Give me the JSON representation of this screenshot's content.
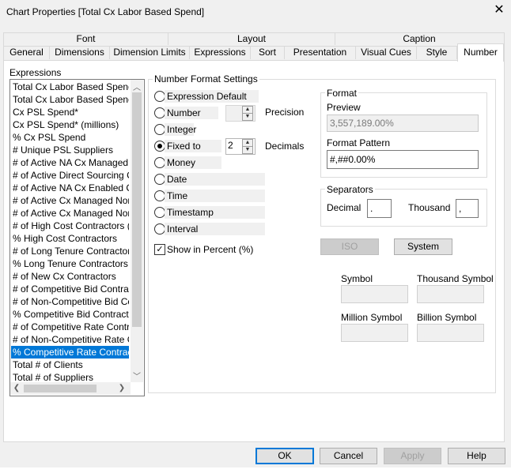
{
  "window": {
    "title": "Chart Properties [Total Cx Labor Based Spend]",
    "close": "✕"
  },
  "tabs_row1": [
    "Font",
    "Layout",
    "Caption"
  ],
  "tabs_row2": [
    "General",
    "Dimensions",
    "Dimension Limits",
    "Expressions",
    "Sort",
    "Presentation",
    "Visual Cues",
    "Style",
    "Number"
  ],
  "active_tab": "Number",
  "expressions": {
    "label": "Expressions",
    "items": [
      "Total Cx Labor Based Spend",
      "Total Cx Labor Based Spend (m",
      "Cx PSL Spend*",
      "Cx PSL Spend* (millions)",
      "% Cx PSL Spend",
      "# Unique PSL Suppliers",
      "# of Active NA Cx Managed Co",
      "# of Active Direct Sourcing Cor",
      "# of Active NA Cx Enabled Con",
      "# of Active Cx Managed Non-C",
      "# of Active Cx Managed Non-C",
      "# of High Cost Contractors (Bill",
      "% High Cost Contractors",
      "# of Long Tenure Contractors (",
      "% Long Tenure Contractors",
      "# of New Cx Contractors",
      "# of Competitive Bid Contractor",
      "# of Non-Competitive Bid Contr",
      " % Competitive Bid Contractors",
      "# of Competitive Rate Contracto",
      "# of Non-Competitive Rate Con",
      " % Competitive Rate Contractor",
      "Total # of Clients",
      "Total # of Suppliers"
    ],
    "selected_index": 21
  },
  "number_format": {
    "group_label": "Number Format Settings",
    "options": [
      "Expression Default",
      "Number",
      "Integer",
      "Fixed to",
      "Money",
      "Date",
      "Time",
      "Timestamp",
      "Interval"
    ],
    "selected": "Fixed to",
    "precision_label": "Precision",
    "precision_value": "",
    "decimals_label": "Decimals",
    "decimals_value": "2",
    "show_percent_label": "Show in Percent (%)",
    "show_percent_checked": true,
    "check_mark": "✓"
  },
  "format": {
    "group_label": "Format",
    "preview_label": "Preview",
    "preview_value": "3,557,189.00%",
    "pattern_label": "Format Pattern",
    "pattern_value": "#,##0.00%"
  },
  "separators": {
    "group_label": "Separators",
    "decimal_label": "Decimal",
    "decimal_value": ".",
    "thousand_label": "Thousand",
    "thousand_value": ","
  },
  "buttons": {
    "iso": "ISO",
    "system": "System",
    "ok": "OK",
    "cancel": "Cancel",
    "apply": "Apply",
    "help": "Help"
  },
  "symbols": {
    "symbol_label": "Symbol",
    "thousand_symbol_label": "Thousand Symbol",
    "million_symbol_label": "Million Symbol",
    "billion_symbol_label": "Billion Symbol"
  },
  "icons": {
    "up": "▲",
    "down": "▼",
    "left": "❮",
    "right": "❯",
    "vup": "︿",
    "vdown": "﹀"
  },
  "colors": {
    "selection": "#0078d7",
    "primary_border": "#0078d7"
  }
}
